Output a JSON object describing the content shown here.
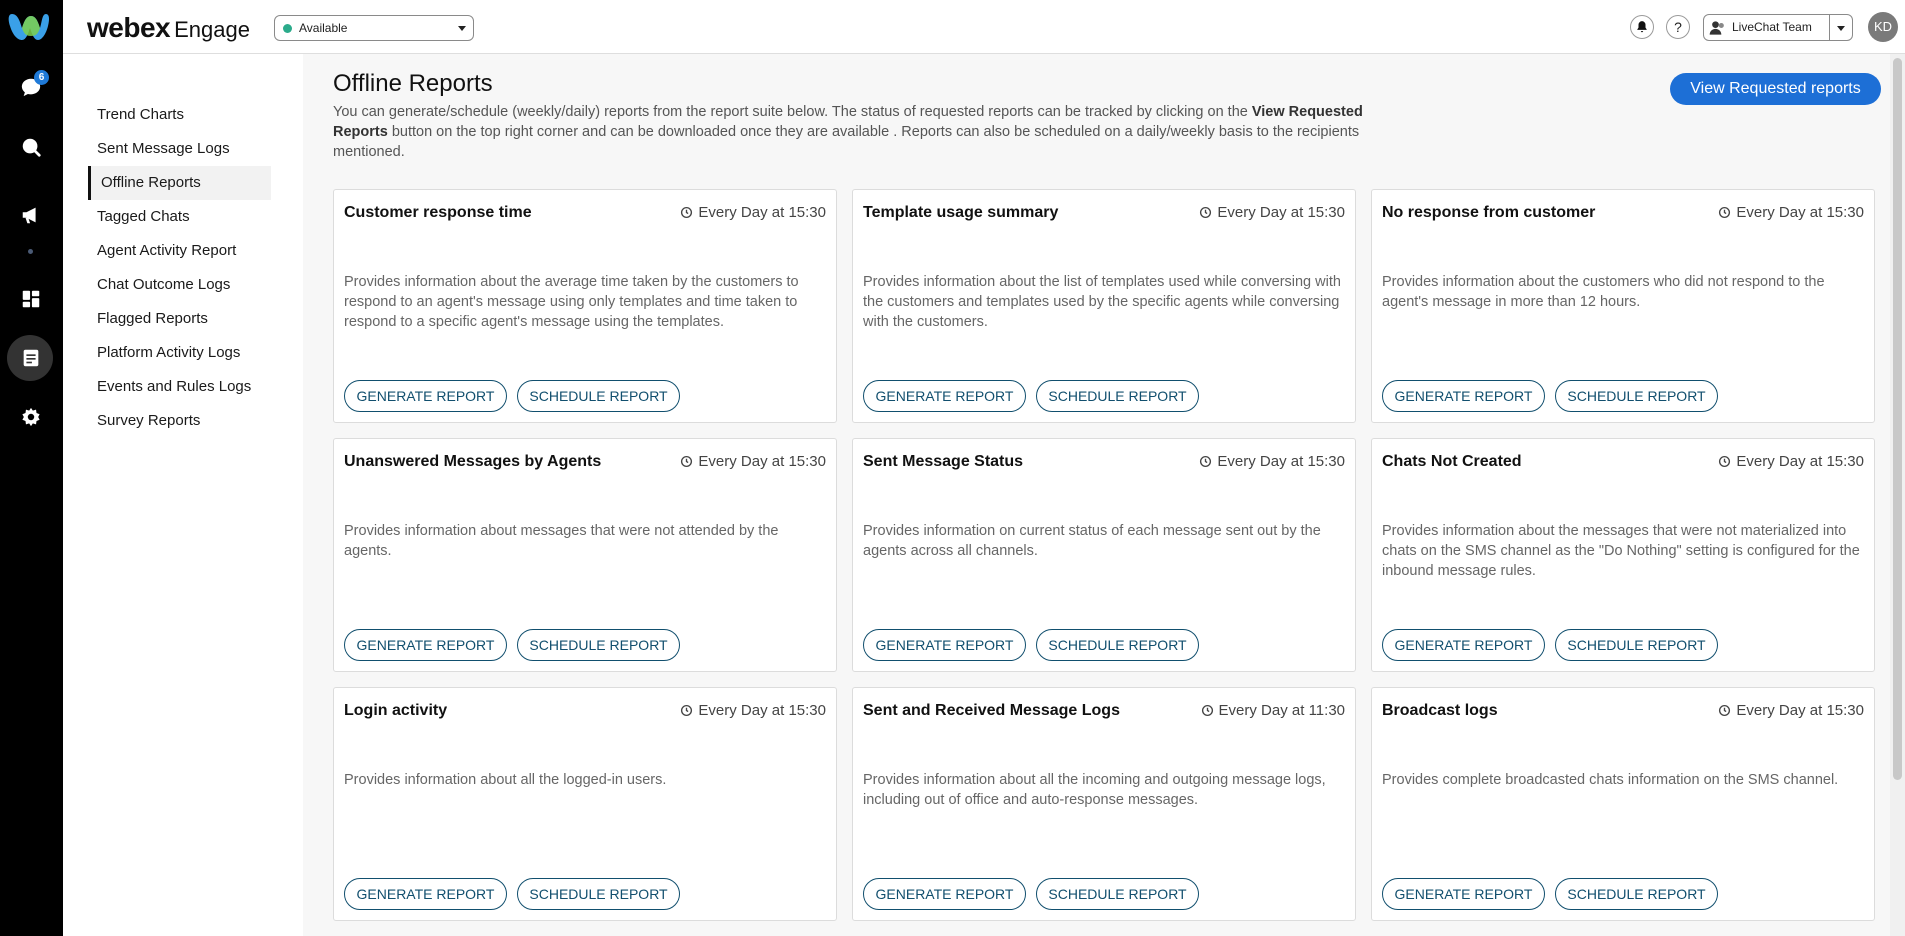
{
  "rail": {
    "badge_count": "6",
    "icons": [
      "webex-logo-icon",
      "chat-icon",
      "search-icon",
      "megaphone-icon",
      "dashboard-icon",
      "reports-icon",
      "settings-icon"
    ]
  },
  "header": {
    "brand": "webex",
    "brand_sub": "Engage",
    "status": "Available",
    "help": "?",
    "team": "LiveChat Team",
    "avatar": "KD"
  },
  "sidenav": {
    "items": [
      "Trend Charts",
      "Sent Message Logs",
      "Offline Reports",
      "Tagged Chats",
      "Agent Activity Report",
      "Chat Outcome Logs",
      "Flagged Reports",
      "Platform Activity Logs",
      "Events and Rules Logs",
      "Survey Reports"
    ],
    "active_index": 2
  },
  "main": {
    "title": "Offline Reports",
    "desc_part1": "You can generate/schedule (weekly/daily) reports from the report suite below. The status of requested reports can be tracked by clicking on the ",
    "desc_bold": "View Requested Reports",
    "desc_part2": " button on the top right corner and can be downloaded once they are available . Reports can also be scheduled on a daily/weekly basis to the recipients mentioned.",
    "view_button": "View Requested reports",
    "generate_label": "GENERATE REPORT",
    "schedule_label": "SCHEDULE REPORT",
    "cards": [
      {
        "title": "Customer response time",
        "schedule": "Every Day at 15:30",
        "desc": "Provides information about the average time taken by the customers to respond to an agent's message using only templates and time taken to respond to a specific agent's message using the templates."
      },
      {
        "title": "Template usage summary",
        "schedule": "Every Day at 15:30",
        "desc": "Provides information about the list of templates used while conversing with the customers and templates used by the specific agents while conversing with the customers."
      },
      {
        "title": "No response from customer",
        "schedule": "Every Day at 15:30",
        "desc": "Provides information about the customers who did not respond to the agent's message in more than 12 hours."
      },
      {
        "title": "Unanswered Messages by Agents",
        "schedule": "Every Day at 15:30",
        "desc": "Provides information about messages that were not attended by the agents."
      },
      {
        "title": "Sent Message Status",
        "schedule": "Every Day at 15:30",
        "desc": "Provides information on current status of each message sent out by the agents across all channels."
      },
      {
        "title": "Chats Not Created",
        "schedule": "Every Day at 15:30",
        "desc": "Provides information about the messages that were not materialized into chats on the SMS channel as the \"Do Nothing\" setting is configured for the inbound message rules."
      },
      {
        "title": "Login activity",
        "schedule": "Every Day at 15:30",
        "desc": "Provides information about all the logged-in users."
      },
      {
        "title": "Sent and Received Message Logs",
        "schedule": "Every Day at 11:30",
        "desc": "Provides information about all the incoming and outgoing message logs, including out of office and auto-response messages."
      },
      {
        "title": "Broadcast logs",
        "schedule": "Every Day at 15:30",
        "desc": "Provides complete broadcasted chats information on the SMS channel."
      }
    ]
  },
  "colors": {
    "primary": "#1d6fd6",
    "outline_button": "#114f6e",
    "available": "#2bab8b",
    "rail": "#000000"
  }
}
